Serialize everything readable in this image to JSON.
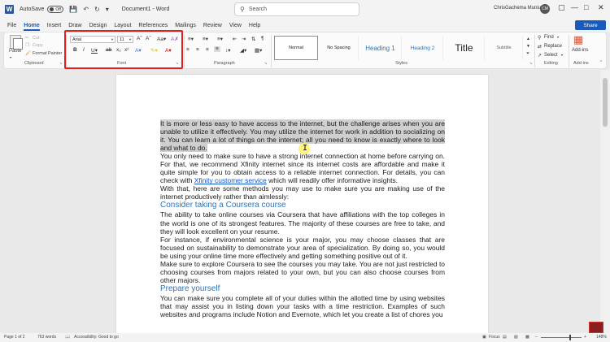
{
  "titlebar": {
    "autosave_label": "AutoSave",
    "autosave_state": "Off",
    "doc_title": "Document1 - Word",
    "search_placeholder": "Search",
    "user_name": "ChrisGachema Muniu",
    "user_initials": "CM"
  },
  "menu": {
    "tabs": [
      "File",
      "Home",
      "Insert",
      "Draw",
      "Design",
      "Layout",
      "References",
      "Mailings",
      "Review",
      "View",
      "Help"
    ],
    "active": "Home",
    "share_label": "Share"
  },
  "ribbon": {
    "clipboard": {
      "paste": "Paste",
      "cut": "Cut",
      "copy": "Copy",
      "format_painter": "Format Painter",
      "label": "Clipboard"
    },
    "font": {
      "family": "Arial",
      "size": "11",
      "label": "Font"
    },
    "paragraph": {
      "label": "Paragraph"
    },
    "styles": {
      "items": [
        "Normal",
        "No Spacing",
        "Heading 1",
        "Heading 2",
        "Title",
        "Subtitle"
      ],
      "label": "Styles"
    },
    "editing": {
      "find": "Find",
      "replace": "Replace",
      "select": "Select",
      "label": "Editing"
    },
    "addins": {
      "label": "Add-ins",
      "button": "Add-ins"
    }
  },
  "document": {
    "para1_selected": "It is more or less easy to have access to the internet, but the challenge arises when you are unable to utilize it effectively. You may utilize the internet for work in addition to socializing on it. You can learn a lot of things on the internet; all you need to know is exactly where to look and what to do.",
    "para2_before_link": "You only need to make sure to have a strong internet connection at home before carrying on. For that, we recommend Xfinity internet since its internet costs are affordable and make it quite simple for you to obtain access to a reliable internet connection. For details, you can check with ",
    "para2_link": "Xfinity customer service",
    "para2_after_link": " which will readily offer informative insights.",
    "para3": "With that, here are some methods you may use to make sure you are making use of the internet productively rather than aimlessly:",
    "heading1": "Consider taking a Coursera course",
    "para4": "The ability to take online courses via Coursera that have affiliations with the top colleges in the world is one of its strongest features. The majority of these courses are free to take, and they will look excellent on your resume.",
    "para5": "For instance, if environmental science is your major, you may choose classes that are focused on sustainability to demonstrate your area of specialization. By doing so, you would be using your online time more effectively and getting something positive out of it.",
    "para6": "Make sure to explore Coursera to see the courses you may take. You are not just restricted to choosing courses from majors related to your own, but you can also choose courses from other majors.",
    "heading2": "Prepare yourself",
    "para7": "You can make sure you complete all of your duties within the allotted time by using websites that may assist you in listing down your tasks with a time restriction. Examples of such websites and programs include Notion and Evernote, which let you create a list of chores you"
  },
  "status": {
    "page": "Page 1 of 2",
    "words": "763 words",
    "accessibility": "Accessibility: Good to go",
    "focus": "Focus",
    "zoom": "148%"
  },
  "colors": {
    "accent": "#185abd",
    "heading": "#2e74b5",
    "highlight_box": "#e02020",
    "selection": "#cfcfcf"
  }
}
